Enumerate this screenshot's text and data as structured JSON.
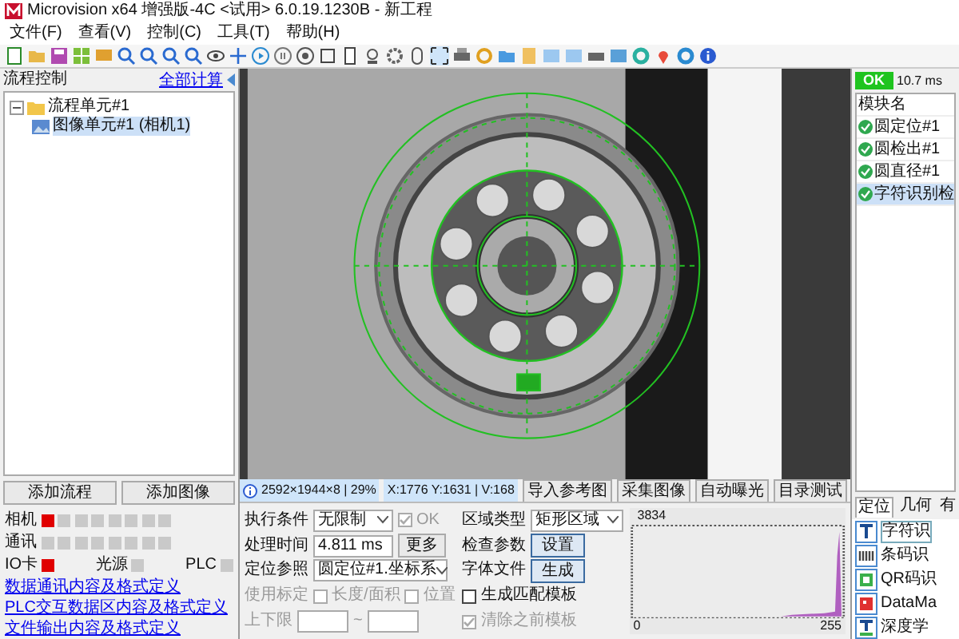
{
  "window": {
    "title": "Microvision x64 增强版-4C <试用> 6.0.19.1230B - 新工程"
  },
  "menu": [
    "文件(F)",
    "查看(V)",
    "控制(C)",
    "工具(T)",
    "帮助(H)"
  ],
  "flow_panel": {
    "title": "流程控制",
    "action": "全部计算",
    "tree": [
      {
        "label": "流程单元#1",
        "expanded": true,
        "selected": false,
        "children": [
          {
            "label": "图像单元#1 (相机1)",
            "selected": true
          }
        ]
      }
    ]
  },
  "flow_buttons": [
    "添加流程",
    "添加图像"
  ],
  "status_rows": [
    {
      "items": [
        {
          "label": "相机",
          "lights": [
            {
              "on": true
            },
            {
              "on": false
            },
            {
              "on": false
            },
            {
              "on": false
            },
            {
              "on": false
            },
            {
              "on": false
            },
            {
              "on": false
            },
            {
              "on": false
            }
          ]
        }
      ]
    },
    {
      "items": [
        {
          "label": "通讯",
          "lights": [
            {
              "on": false
            },
            {
              "on": false
            },
            {
              "on": false
            },
            {
              "on": false
            },
            {
              "on": false
            },
            {
              "on": false
            },
            {
              "on": false
            },
            {
              "on": false
            }
          ]
        }
      ]
    },
    {
      "items": [
        {
          "label": "IO卡",
          "lights": [
            {
              "on": true
            }
          ]
        },
        {
          "label": "光源",
          "lights": [
            {
              "on": false
            }
          ]
        },
        {
          "label": "PLC",
          "lights": [
            {
              "on": false
            }
          ]
        }
      ]
    }
  ],
  "links": [
    "数据通讯内容及格式定义",
    "PLC交互数据区内容及格式定义",
    "文件输出内容及格式定义"
  ],
  "image_status": {
    "size": "2592×1944×8 | 29%",
    "cursor": "X:1776 Y:1631 | V:168"
  },
  "image_buttons": [
    "导入参考图",
    "采集图像",
    "自动曝光",
    "目录测试"
  ],
  "left_form": [
    {
      "kind": "select",
      "label": "执行条件",
      "value": "无限制",
      "check": {
        "label": "OK",
        "checked": true,
        "disabled": true
      }
    },
    {
      "kind": "input",
      "label": "处理时间",
      "value": "4.811 ms",
      "button": "更多"
    },
    {
      "kind": "select",
      "label": "定位参照",
      "value": "圆定位#1.坐标系"
    },
    {
      "kind": "checks",
      "label": "使用标定",
      "disabled": true,
      "checks": [
        {
          "label": "长度/面积",
          "checked": false
        },
        {
          "label": "位置",
          "checked": false
        }
      ]
    },
    {
      "kind": "range",
      "label": "上下限",
      "disabled": true,
      "separator": "~"
    }
  ],
  "right_form": [
    {
      "kind": "select",
      "label": "区域类型",
      "value": "矩形区域"
    },
    {
      "kind": "button",
      "label": "检查参数",
      "button": "设置"
    },
    {
      "kind": "button",
      "label": "字体文件",
      "button": "生成"
    },
    {
      "kind": "check",
      "label": "生成匹配模板",
      "checked": false,
      "disabled": false
    },
    {
      "kind": "check",
      "label": "清除之前模板",
      "checked": true,
      "disabled": true
    }
  ],
  "histogram": {
    "y_max": "3834",
    "x_min": "0",
    "x_max": "255"
  },
  "result_panel": {
    "status": "OK",
    "time": "10.7 ms",
    "column": "模块名",
    "rows": [
      {
        "label": "圆定位#1",
        "selected": false
      },
      {
        "label": "圆检出#1",
        "selected": false
      },
      {
        "label": "圆直径#1",
        "selected": false
      },
      {
        "label": "字符识别检",
        "selected": true
      }
    ]
  },
  "tool_tabs": [
    {
      "label": "定位",
      "selected": true
    },
    {
      "label": "几何",
      "selected": false
    },
    {
      "label": "有",
      "selected": false
    }
  ],
  "tools": [
    {
      "label": "字符识",
      "kind": "text",
      "selected": true
    },
    {
      "label": "条码识",
      "kind": "barcode",
      "selected": false
    },
    {
      "label": "QR码识",
      "kind": "qr",
      "selected": false
    },
    {
      "label": "DataMa",
      "kind": "datamatrix",
      "selected": false
    },
    {
      "label": "深度学",
      "kind": "deep",
      "selected": false
    }
  ]
}
